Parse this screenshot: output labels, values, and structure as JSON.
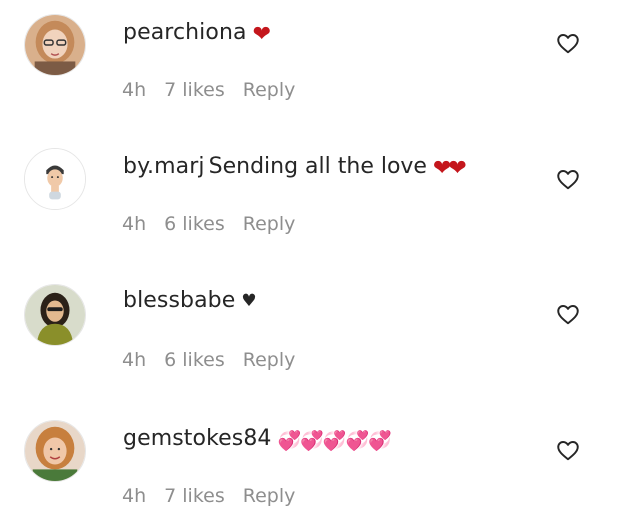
{
  "comments": [
    {
      "username": "pearchiona",
      "text": "",
      "emoji": "❤",
      "time": "4h",
      "likes": "7 likes",
      "reply": "Reply"
    },
    {
      "username": "by.marj",
      "text": "Sending all the love",
      "emoji": "❤❤",
      "time": "4h",
      "likes": "6 likes",
      "reply": "Reply"
    },
    {
      "username": "blessbabe",
      "text": "",
      "emoji": "♥",
      "time": "4h",
      "likes": "6 likes",
      "reply": "Reply"
    },
    {
      "username": "gemstokes84",
      "text": "",
      "emoji": "💞💞💞💞💞",
      "time": "4h",
      "likes": "7 likes",
      "reply": "Reply"
    }
  ],
  "icons": {
    "like": "heart-outline-icon",
    "avatar": "user-avatar"
  },
  "colors": {
    "text": "#262626",
    "meta": "#8e8e8e",
    "heart_red": "#c4161c"
  }
}
